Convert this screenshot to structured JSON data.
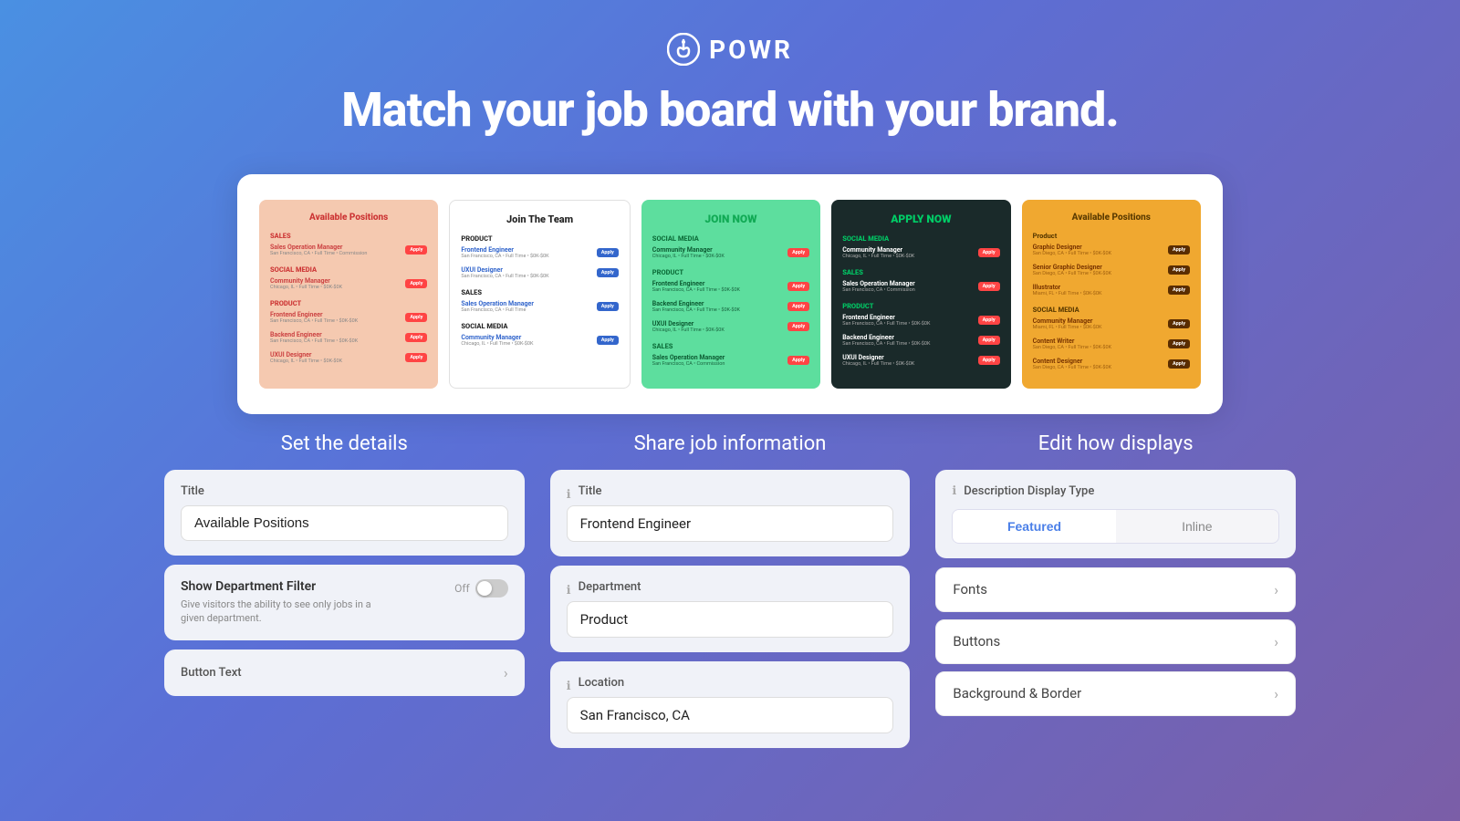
{
  "header": {
    "logo_text": "POWR",
    "headline": "Match your job board with your brand."
  },
  "preview_cards": [
    {
      "id": "card1",
      "theme": "salmon",
      "title": "Available Positions",
      "departments": [
        {
          "name": "SALES",
          "jobs": [
            {
              "title": "Sales Operation Manager",
              "meta": "San Francisco, CA • Full Time • Commission Based",
              "btn": "Apply"
            },
            {
              "title": "Community Manager",
              "meta": "Chicago, IL • Full Time • $0K-$0K",
              "btn": "Apply"
            }
          ]
        },
        {
          "name": "PRODUCT",
          "jobs": [
            {
              "title": "Frontend Engineer",
              "meta": "San Francisco, CA • Full Time • $0K-$0K",
              "btn": "Apply"
            },
            {
              "title": "Backend Engineer",
              "meta": "San Francisco, CA • Full Time • $0K-$0K",
              "btn": "Apply"
            },
            {
              "title": "UXUI Designer",
              "meta": "Chicago, IL • Full Time • $0K-$0K",
              "btn": "Apply"
            }
          ]
        }
      ]
    },
    {
      "id": "card2",
      "theme": "white",
      "title": "Join The Team",
      "departments": [
        {
          "name": "PRODUCT",
          "jobs": [
            {
              "title": "Frontend Engineer",
              "meta": "San Francisco, CA • Full Time • $0K-$0K",
              "btn": "Apply"
            },
            {
              "title": "UXUI Designer",
              "meta": "San Francisco, CA • Full Time • $0K-$0K",
              "btn": "Apply"
            }
          ]
        },
        {
          "name": "SALES",
          "jobs": [
            {
              "title": "Sales Operation Manager",
              "meta": "San Francisco, CA • Full Time • Commission Based",
              "btn": "Apply"
            }
          ]
        },
        {
          "name": "SOCIAL MEDIA",
          "jobs": [
            {
              "title": "Community Manager",
              "meta": "Chicago, IL • Full Time • $0K-$0K",
              "btn": "Apply"
            }
          ]
        }
      ]
    },
    {
      "id": "card3",
      "theme": "green",
      "title": "JOIN NOW",
      "departments": [
        {
          "name": "SOCIAL MEDIA",
          "jobs": [
            {
              "title": "Community Manager",
              "meta": "Chicago, IL • Full Time • $0K-$0K",
              "btn": "Apply"
            }
          ]
        },
        {
          "name": "PRODUCT",
          "jobs": [
            {
              "title": "Frontend Engineer",
              "meta": "San Francisco, CA • Full Time • $0K-$0K",
              "btn": "Apply"
            },
            {
              "title": "Backend Engineer",
              "meta": "San Francisco, CA • Full Time • $0K-$0K",
              "btn": "Apply"
            },
            {
              "title": "UXUI Designer",
              "meta": "Chicago, IL • Full Time • $0K-$0K",
              "btn": "Apply"
            }
          ]
        },
        {
          "name": "SALES",
          "jobs": [
            {
              "title": "Sales Operation Manager",
              "meta": "San Francisco, CA • Full Time • Commission Based",
              "btn": "Apply"
            }
          ]
        }
      ]
    },
    {
      "id": "card4",
      "theme": "dark",
      "title": "APPLY NOW",
      "departments": [
        {
          "name": "SOCIAL MEDIA",
          "jobs": [
            {
              "title": "Community Manager",
              "meta": "Chicago, IL • Full Time • $0K-$0K",
              "btn": "Apply"
            }
          ]
        },
        {
          "name": "PRODUCT",
          "jobs": [
            {
              "title": "Frontend Engineer",
              "meta": "San Francisco, CA • Full Time • $0K-$0K",
              "btn": "Apply"
            },
            {
              "title": "Backend Engineer",
              "meta": "San Francisco, CA • Full Time • $0K-$0K",
              "btn": "Apply"
            },
            {
              "title": "UXUI Designer",
              "meta": "Chicago, IL • Full Time • $0K-$0K",
              "btn": "Apply"
            }
          ]
        }
      ]
    },
    {
      "id": "card5",
      "theme": "orange",
      "title": "Available Positions",
      "departments": [
        {
          "name": "Product",
          "jobs": [
            {
              "title": "Graphic Designer",
              "meta": "San Diego, CA • Full Time • $0K-$0K",
              "btn": "Apply"
            },
            {
              "title": "Senior Graphic Designer",
              "meta": "San Diego, CA • Full Time • $0K-$0K",
              "btn": "Apply"
            },
            {
              "title": "Illustrator",
              "meta": "Miami, FL • Full Time • $0K-$0K",
              "btn": "Apply"
            }
          ]
        },
        {
          "name": "SOCIAL MEDIA",
          "jobs": [
            {
              "title": "Community Manager",
              "meta": "Miami, FL • Full Time • $0K-$0K",
              "btn": "Apply"
            },
            {
              "title": "Content Writer",
              "meta": "San Diego, CA • Full Time • $0K-$0K",
              "btn": "Apply"
            },
            {
              "title": "Content Designer",
              "meta": "San Diego, CA • Full Time • $0K-$0K",
              "btn": "Apply"
            }
          ]
        }
      ]
    }
  ],
  "sections": {
    "details": {
      "heading": "Set the details",
      "title_label": "Title",
      "title_value": "Available Positions",
      "dept_filter_label": "Show Department Filter",
      "dept_filter_desc": "Give visitors the ability to see only jobs in a given department.",
      "toggle_state": "Off",
      "button_text_label": "Button Text"
    },
    "share": {
      "heading": "Share job information",
      "title_label": "Title",
      "title_info": "ℹ",
      "title_value": "Frontend Engineer",
      "dept_label": "Department",
      "dept_info": "ℹ",
      "dept_value": "Product",
      "location_label": "Location",
      "location_info": "ℹ",
      "location_value": "San Francisco, CA"
    },
    "display": {
      "heading": "Edit how displays",
      "desc_type_label": "Description Display Type",
      "desc_info": "ℹ",
      "featured_btn": "Featured",
      "inline_btn": "Inline",
      "fonts_label": "Fonts",
      "buttons_label": "Buttons",
      "background_label": "Background & Border"
    }
  }
}
